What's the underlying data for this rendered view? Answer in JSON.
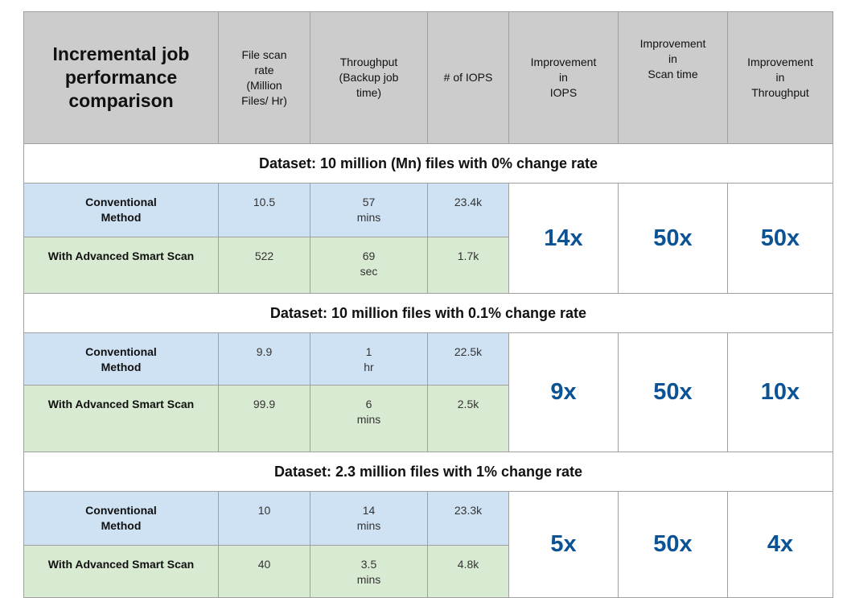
{
  "header": {
    "title_lines": [
      "Incremental job",
      "performance",
      "comparison"
    ],
    "scan_rate_lines": [
      "File scan",
      "rate",
      "(Million",
      "Files/ Hr)"
    ],
    "throughput_lines": [
      "Throughput",
      "(Backup job",
      "time)"
    ],
    "iops": "# of IOPS",
    "impr_iops_lines": [
      "Improvement",
      "in",
      "IOPS"
    ],
    "impr_scan_lines": [
      "Improvement",
      "in",
      "Scan time"
    ],
    "impr_throughput_lines": [
      "Improvement",
      "in",
      "Throughput"
    ]
  },
  "colors": {
    "header_bg": "#cccccc",
    "conventional_bg": "#cfe2f3",
    "smart_scan_bg": "#d9ead3",
    "improvement_text": "#0b5394",
    "border": "#a0a0a0"
  },
  "datasets": [
    {
      "label": "Dataset: 10 million (Mn) files with 0% change rate",
      "conventional": {
        "method_lines": [
          "Conventional",
          "Method"
        ],
        "scan_rate": "10.5",
        "throughput_lines": [
          "57",
          "mins"
        ],
        "iops": "23.4k"
      },
      "smart": {
        "method_lines": [
          "With Advanced Smart Scan"
        ],
        "scan_rate": "522",
        "throughput_lines": [
          "69",
          "sec"
        ],
        "iops": "1.7k"
      },
      "improvement": {
        "iops": "14x",
        "scan_time": "50x",
        "throughput": "50x"
      }
    },
    {
      "label": "Dataset: 10 million files with 0.1% change rate",
      "conventional": {
        "method_lines": [
          "Conventional",
          "Method"
        ],
        "scan_rate": "9.9",
        "throughput_lines": [
          "1",
          "hr"
        ],
        "iops": "22.5k"
      },
      "smart": {
        "method_lines": [
          "With Advanced Smart Scan"
        ],
        "scan_rate": "99.9",
        "throughput_lines": [
          "6",
          "mins"
        ],
        "iops": "2.5k"
      },
      "improvement": {
        "iops": "9x",
        "scan_time": "50x",
        "throughput": "10x"
      }
    },
    {
      "label": "Dataset: 2.3 million files with 1% change rate",
      "conventional": {
        "method_lines": [
          "Conventional",
          "Method"
        ],
        "scan_rate": "10",
        "throughput_lines": [
          "14",
          "mins"
        ],
        "iops": "23.3k"
      },
      "smart": {
        "method_lines": [
          "With Advanced Smart Scan"
        ],
        "scan_rate": "40",
        "throughput_lines": [
          "3.5",
          "mins"
        ],
        "iops": "4.8k"
      },
      "improvement": {
        "iops": "5x",
        "scan_time": "50x",
        "throughput": "4x"
      }
    }
  ]
}
